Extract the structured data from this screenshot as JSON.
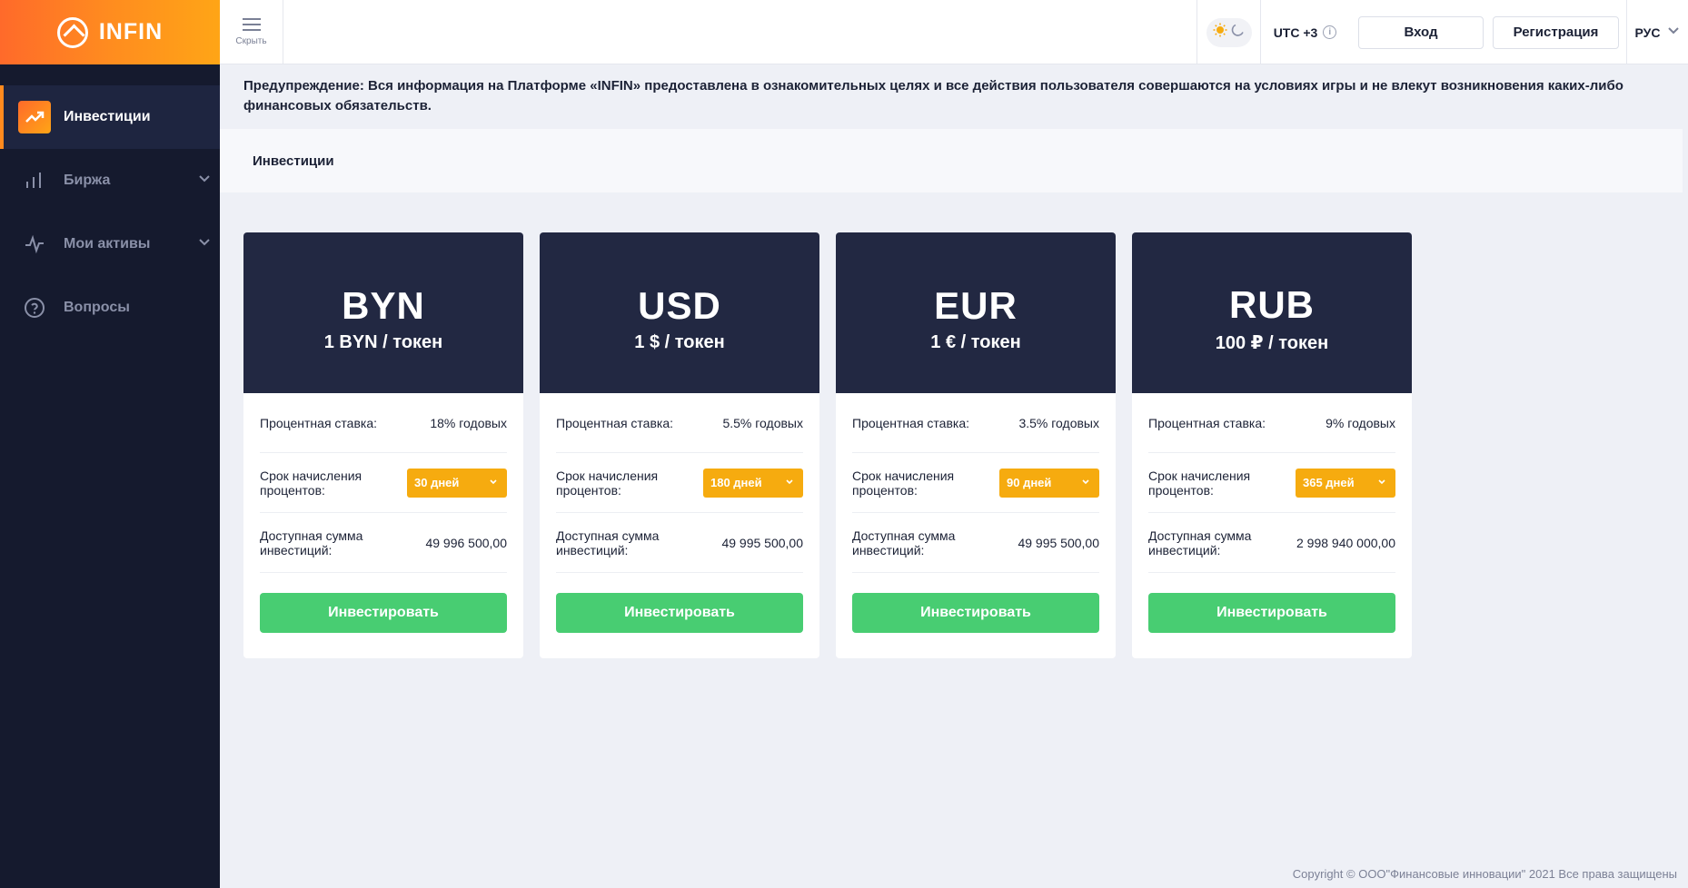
{
  "brand": {
    "name": "INFIN"
  },
  "sidebar": {
    "items": [
      {
        "label": "Инвестиции",
        "icon": "trending-up-icon",
        "active": true
      },
      {
        "label": "Биржа",
        "icon": "bar-chart-icon",
        "expandable": true
      },
      {
        "label": "Мои активы",
        "icon": "activity-icon",
        "expandable": true
      },
      {
        "label": "Вопросы",
        "icon": "help-circle-icon"
      }
    ]
  },
  "header": {
    "hide_label": "Скрыть",
    "timezone": "UTC +3",
    "login_label": "Вход",
    "register_label": "Регистрация",
    "language": "РУС"
  },
  "warning": "Предупреждение: Вся информация на Платформе «INFIN» предоставлена в ознакомительных целях и все действия пользователя совершаются на условиях игры и не влекут возникновения каких-либо финансовых обязательств.",
  "breadcrumb": "Инвестиции",
  "labels": {
    "rate": "Процентная ставка:",
    "term": "Срок начисления процентов:",
    "available": "Доступная сумма инвестиций:",
    "invest": "Инвестировать"
  },
  "cards": [
    {
      "code": "BYN",
      "price": "1 BYN / токен",
      "rate": "18% годовых",
      "term": "30 дней",
      "available": "49 996 500,00"
    },
    {
      "code": "USD",
      "price": "1 $ / токен",
      "rate": "5.5% годовых",
      "term": "180 дней",
      "available": "49 995 500,00"
    },
    {
      "code": "EUR",
      "price": "1 € / токен",
      "rate": "3.5% годовых",
      "term": "90 дней",
      "available": "49 995 500,00"
    },
    {
      "code": "RUB",
      "price": "100 ₽ / токен",
      "rate": "9% годовых",
      "term": "365 дней",
      "available": "2 998 940 000,00"
    }
  ],
  "copyright": "Copyright © ООО\"Финансовые инновации\" 2021 Все права защищены",
  "colors": {
    "accent_orange": "#ff8a1e",
    "sidebar_bg": "#151a2e",
    "card_head": "#222842",
    "select_bg": "#f6ab0f",
    "invest_green": "#48cd72"
  }
}
